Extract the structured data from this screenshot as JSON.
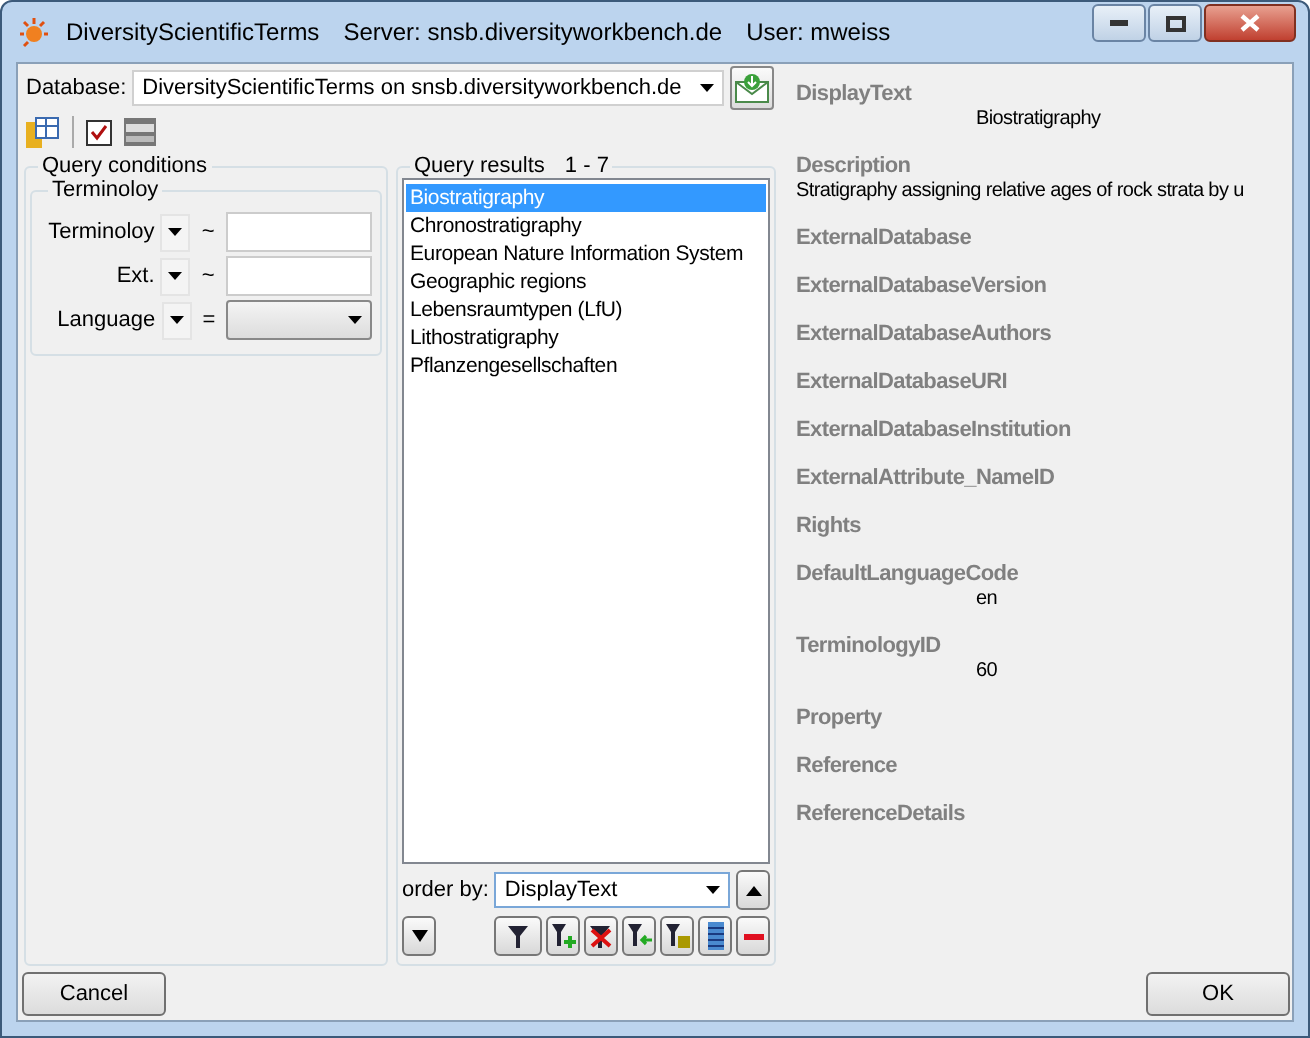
{
  "window": {
    "app_title": "DiversityScientificTerms",
    "server": "Server: snsb.diversityworkbench.de",
    "user": "User: mweiss"
  },
  "database": {
    "label": "Database:",
    "value": "DiversityScientificTerms on snsb.diversityworkbench.de"
  },
  "query_conditions": {
    "title": "Query conditions",
    "group": "Terminoloy",
    "rows": [
      {
        "label": "Terminoloy",
        "operator": "~",
        "kind": "text"
      },
      {
        "label": "Ext.",
        "operator": "~",
        "kind": "text"
      },
      {
        "label": "Language",
        "operator": "=",
        "kind": "dropdown"
      }
    ]
  },
  "query_results": {
    "title": "Query results",
    "range": "1 - 7",
    "items": [
      {
        "text": "Biostratigraphy",
        "selected": true
      },
      {
        "text": "Chronostratigraphy",
        "selected": false
      },
      {
        "text": "European Nature Information System",
        "selected": false
      },
      {
        "text": "Geographic regions",
        "selected": false
      },
      {
        "text": "Lebensraumtypen (LfU)",
        "selected": false
      },
      {
        "text": "Lithostratigraphy",
        "selected": false
      },
      {
        "text": "Pflanzengesellschaften",
        "selected": false
      }
    ],
    "order_by": {
      "label": "order by:",
      "value": "DisplayText"
    }
  },
  "details": [
    {
      "label": "DisplayText",
      "value": "Biostratigraphy",
      "kind": "indented"
    },
    {
      "label": "Description",
      "value": "Stratigraphy assigning relative ages of rock strata by u",
      "kind": "full"
    },
    {
      "label": "ExternalDatabase"
    },
    {
      "label": "ExternalDatabaseVersion"
    },
    {
      "label": "ExternalDatabaseAuthors"
    },
    {
      "label": "ExternalDatabaseURI"
    },
    {
      "label": "ExternalDatabaseInstitution"
    },
    {
      "label": "ExternalAttribute_NameID"
    },
    {
      "label": "Rights"
    },
    {
      "label": "DefaultLanguageCode",
      "value": "en",
      "kind": "indented"
    },
    {
      "label": "TerminologyID",
      "value": "60",
      "kind": "indented"
    },
    {
      "label": "Property"
    },
    {
      "label": "Reference"
    },
    {
      "label": "ReferenceDetails"
    }
  ],
  "buttons": {
    "cancel": "Cancel",
    "ok": "OK"
  }
}
